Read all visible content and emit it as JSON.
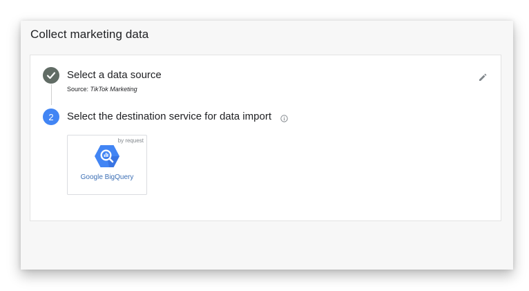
{
  "panel": {
    "title": "Collect marketing data"
  },
  "step1": {
    "title": "Select a data source",
    "source_label": "Source:",
    "source_value": "TikTok Marketing",
    "status_icon": "check-icon",
    "edit_icon": "pencil-icon"
  },
  "step2": {
    "number": "2",
    "title": "Select the destination service for data import",
    "info_icon": "info-icon"
  },
  "services": [
    {
      "name": "Google BigQuery",
      "badge": "by request",
      "icon": "bigquery-logo",
      "logo_color": "#4285f4"
    }
  ],
  "colors": {
    "step_complete": "#616c65",
    "step_active": "#4285f4",
    "tile_label": "#3c6fb5"
  }
}
